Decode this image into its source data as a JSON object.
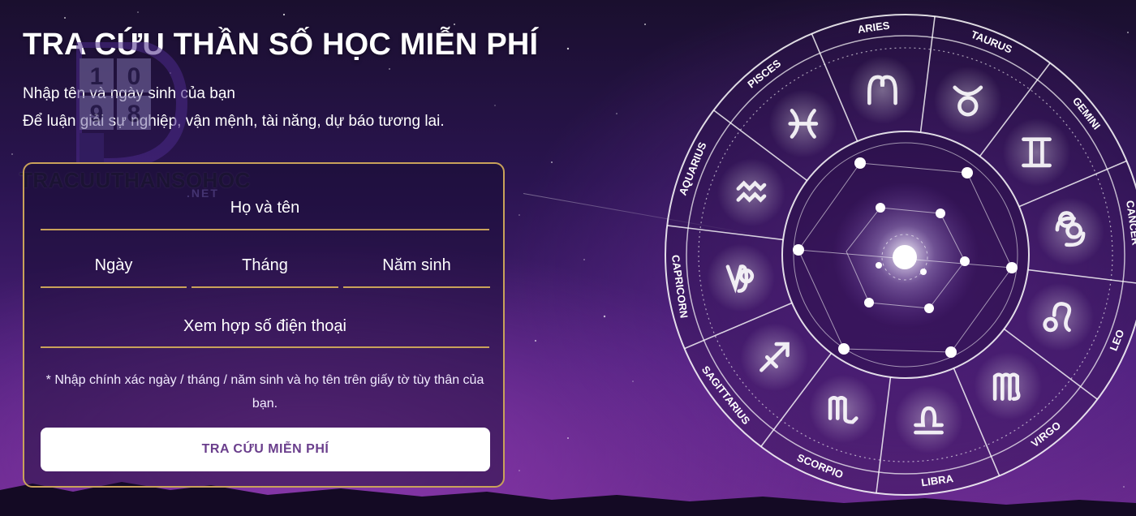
{
  "hero": {
    "title": "TRA CỨU THẦN SỐ HỌC MIỄN PHÍ",
    "subtitle_line1": "Nhập tên và ngày sinh của bạn",
    "subtitle_line2": "Để luận giải sự nghiệp, vận mệnh, tài năng, dự báo tương lai."
  },
  "logo": {
    "digits": [
      "1",
      "0",
      "9",
      "8"
    ],
    "text": "TRACUUTHANSOHOC",
    "suffix": ".NET"
  },
  "form": {
    "name_placeholder": "Họ và tên",
    "day_placeholder": "Ngày",
    "month_placeholder": "Tháng",
    "year_placeholder": "Năm sinh",
    "phone_placeholder": "Xem hợp số điện thoại",
    "note": "* Nhập chính xác ngày / tháng / năm sinh và họ tên trên giấy tờ tùy thân của bạn.",
    "submit_label": "TRA CỨU MIỄN PHÍ"
  },
  "zodiac": {
    "signs": [
      "ARIES",
      "TAURUS",
      "GEMINI",
      "CANCER",
      "LEO",
      "VIRGO",
      "LIBRA",
      "SCORPIO",
      "SAGITTARIUS",
      "CAPRICORN",
      "AQUARIUS",
      "PISCES"
    ]
  },
  "colors": {
    "accent_gold": "#c9a25a",
    "button_text": "#6a3e8c",
    "background_top": "#1a0f2e",
    "background_bottom": "#6a2a8e"
  }
}
